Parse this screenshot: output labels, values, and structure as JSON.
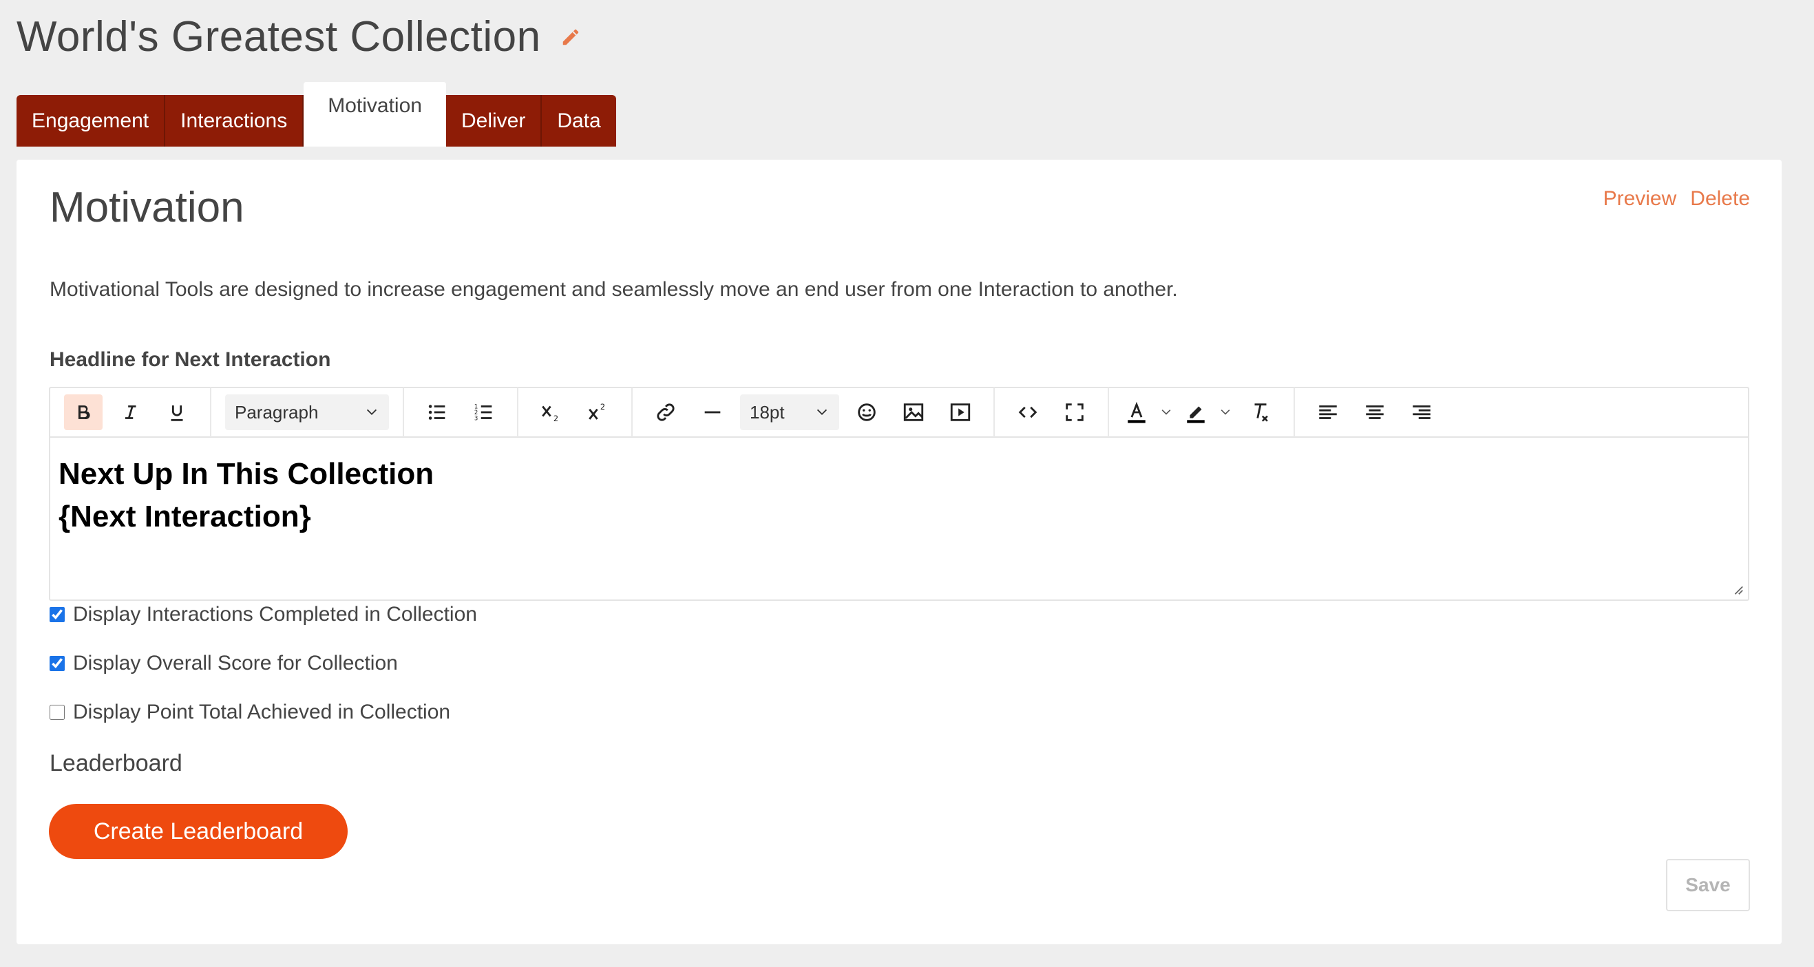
{
  "page": {
    "title": "World's Greatest Collection"
  },
  "tabs": [
    {
      "label": "Engagement"
    },
    {
      "label": "Interactions"
    },
    {
      "label": "Motivation"
    },
    {
      "label": "Deliver"
    },
    {
      "label": "Data"
    }
  ],
  "panel": {
    "heading": "Motivation",
    "preview_label": "Preview",
    "delete_label": "Delete",
    "description": "Motivational Tools are designed to increase engagement and seamlessly move an end user from one Interaction to another."
  },
  "editor": {
    "label": "Headline for Next Interaction",
    "format_value": "Paragraph",
    "font_size_value": "18pt",
    "content_line1": "Next Up In This Collection",
    "content_line2": "{Next Interaction}"
  },
  "checkboxes": [
    {
      "label": "Display Interactions Completed in Collection",
      "checked": true
    },
    {
      "label": "Display Overall Score for Collection",
      "checked": true
    },
    {
      "label": "Display Point Total Achieved in Collection",
      "checked": false
    }
  ],
  "leaderboard": {
    "label": "Leaderboard",
    "create_button": "Create Leaderboard"
  },
  "save_label": "Save",
  "colors": {
    "tab_bg": "#8e1c06",
    "accent": "#ee4a0f",
    "link": "#e8794a",
    "bold_active": "#fde1d5"
  }
}
